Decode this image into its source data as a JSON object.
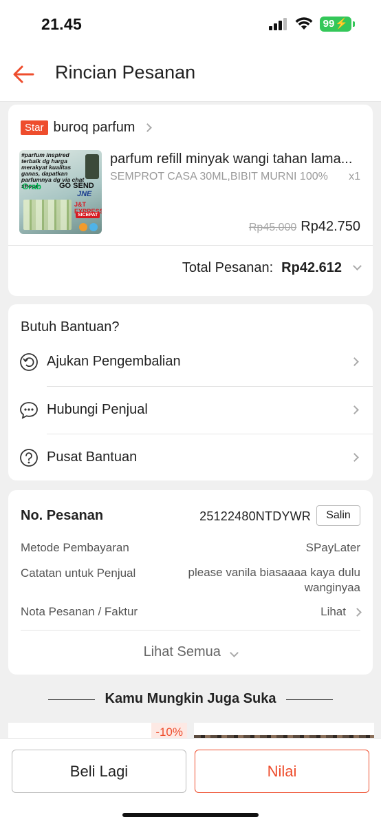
{
  "status_bar": {
    "time": "21.45",
    "battery": "99"
  },
  "header": {
    "title": "Rincian Pesanan",
    "back_icon": "arrow-left-icon"
  },
  "product_card": {
    "badge": "Star",
    "shop_name": "buroq parfum",
    "thumbnail_text": {
      "tagline": "#parfum inspired terbaik dg harga merakyat kualitas ganas, dapatkan parfumnya dg via chat shope",
      "grab": "Grab",
      "gosend": "GO SEND",
      "jne": "JNE",
      "jnt": "J&T EXPRESS",
      "sicepat": "SICEPAT"
    },
    "product_title": "parfum refill minyak wangi tahan lama...",
    "variant": "SEMPROT CASA 30ML,BIBIT MURNI 100%",
    "quantity": "x1",
    "price_original": "Rp45.000",
    "price_final": "Rp42.750",
    "total_label": "Total Pesanan:",
    "total_value": "Rp42.612"
  },
  "help_card": {
    "title": "Butuh Bantuan?",
    "items": [
      {
        "label": "Ajukan Pengembalian",
        "icon": "return-icon"
      },
      {
        "label": "Hubungi Penjual",
        "icon": "chat-icon"
      },
      {
        "label": "Pusat Bantuan",
        "icon": "help-icon"
      }
    ]
  },
  "order_card": {
    "order_label": "No. Pesanan",
    "order_number": "25122480NTDYWR",
    "copy_button": "Salin",
    "payment_label": "Metode Pembayaran",
    "payment_value": "SPayLater",
    "note_label": "Catatan untuk Penjual",
    "note_value": "please vanila biasaaaa kaya dulu wanginyaa",
    "invoice_label": "Nota Pesanan / Faktur",
    "invoice_value": "Lihat",
    "see_all": "Lihat Semua"
  },
  "recommendations": {
    "title": "Kamu Mungkin Juga Suka",
    "discount_badge": "-10%"
  },
  "bottom_bar": {
    "buy_again": "Beli Lagi",
    "rate": "Nilai"
  },
  "colors": {
    "accent": "#ee4d2d",
    "battery": "#34c759"
  }
}
